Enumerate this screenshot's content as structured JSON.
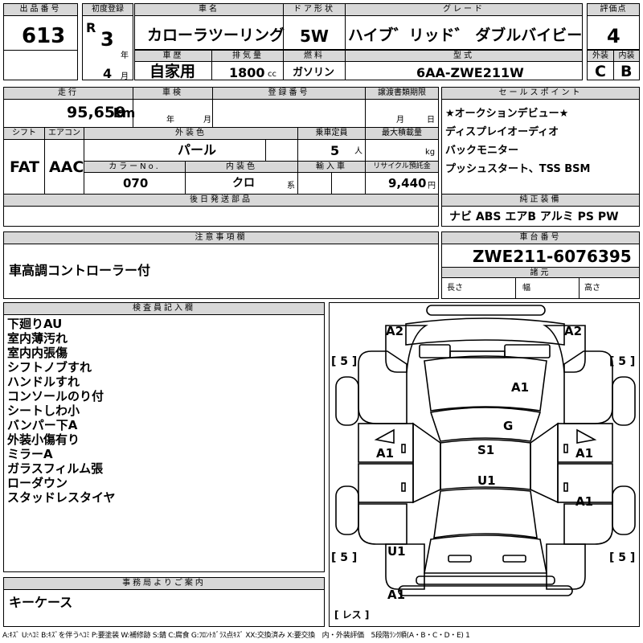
{
  "header": {
    "lot_label": "出品番号",
    "lot_number": "613",
    "first_reg_label": "初度登録",
    "era": "R",
    "year": "3",
    "year_unit": "年",
    "month": "4",
    "month_unit": "月",
    "car_name_label": "車名",
    "car_name": "カローラツーリング",
    "door_label": "ドア形状",
    "door": "5W",
    "grade_label": "グレード",
    "grade": "ハイブ゛リッド゛ ダブルバイビー",
    "score_label": "評価点",
    "score": "4",
    "history_label": "車歴",
    "history": "自家用",
    "displacement_label": "排気量",
    "displacement": "1800",
    "displacement_unit": "cc",
    "fuel_label": "燃料",
    "fuel": "ガソリン",
    "model_label": "型式",
    "model": "6AA-ZWE211W",
    "ext_label": "外装",
    "ext_grade": "C",
    "int_label": "内装",
    "int_grade": "B"
  },
  "row2": {
    "mileage_label": "走行",
    "mileage": "95,659",
    "mileage_unit": "km",
    "inspection_label": "車検",
    "insp_year": "年",
    "insp_month": "月",
    "plate_label": "登録番号",
    "transfer_label": "譲渡書類期限",
    "transfer_month": "月",
    "transfer_day": "日",
    "shift_label": "シフト",
    "shift": "FAT",
    "ac_label": "エアコン",
    "ac": "AAC",
    "color_label": "外装色",
    "color": "パール",
    "capacity_label": "乗車定員",
    "capacity": "5",
    "capacity_unit": "人",
    "load_label": "最大積載量",
    "load_unit": "kg",
    "color_no_label": "カラーNo.",
    "color_no": "070",
    "interior_color_label": "内装色",
    "interior_color": "クロ",
    "interior_color_unit": "系",
    "import_label": "輸入車",
    "recycle_label": "リサイクル預託金",
    "recycle": "9,440",
    "recycle_unit": "円",
    "later_parts_label": "後日発送部品"
  },
  "sales_points": {
    "label": "セールスポイント",
    "items": [
      "★オークションデビュー★",
      "ディスプレイオーディオ",
      "バックモニター",
      "プッシュスタート、TSS BSM"
    ]
  },
  "equipment": {
    "label": "純正装備",
    "value": "ナビ ABS エアB アルミ PS PW"
  },
  "notes": {
    "label": "注意事項欄",
    "text": "車高調コントローラー付"
  },
  "chassis": {
    "label": "車台番号",
    "value": "ZWE211-6076395"
  },
  "specs": {
    "label": "諸元",
    "length": "長さ",
    "width": "幅",
    "height": "高さ"
  },
  "inspector": {
    "label": "検査員記入欄",
    "lines": [
      "下廻りAU",
      "室内薄汚れ",
      "室内内張傷",
      "シフトノブすれ",
      "ハンドルすれ",
      "コンソールのり付",
      "シートしわ小",
      "バンパー下A",
      "外装小傷有り",
      "ミラーA",
      "ガラスフィルム張",
      "ローダウン",
      "スタッドレスタイヤ"
    ]
  },
  "office": {
    "label": "事務局よりご案内",
    "text": "キーケース"
  },
  "diagram": {
    "marks": {
      "front_left": "A2",
      "front_right": "A2",
      "hood": "A1",
      "windshield": "G",
      "left_front_door": "A1",
      "right_front_door": "A1",
      "right_rear_door": "A1",
      "seat_front": "S1",
      "seat_rear": "U1",
      "rear_left": "U1",
      "rear_bumper": "A1"
    },
    "tires": {
      "fl": "[ 5 ]",
      "fr": "[ 5 ]",
      "rl": "[ 5 ]",
      "rr": "[ 5 ]",
      "spare": "[ レス ]"
    }
  },
  "legend": "A:ｷｽﾞ U:ﾍｺﾐ B:ｷｽﾞを伴うﾍｺﾐ P:要塗装 W:補修跡 S:錆 C:腐食 G:ﾌﾛﾝﾄｶﾞﾗｽ点ｷｽﾞ XX:交換済み X:要交換　内・外装評価　5段階ﾗﾝｸ順(A・B・C・D・E) 1"
}
